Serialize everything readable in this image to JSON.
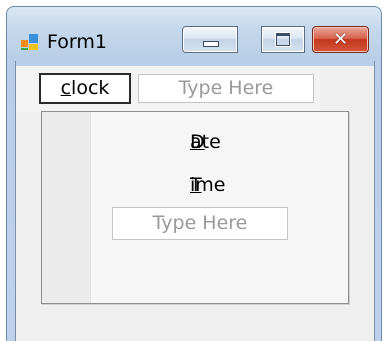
{
  "window": {
    "title": "Form1",
    "icon": "form-icon",
    "controls": {
      "minimize": "minimize-icon",
      "maximize": "maximize-icon",
      "close": "close-icon",
      "close_glyph": "✕"
    }
  },
  "menu": {
    "clock": {
      "mnemonic": "c",
      "rest": "lock"
    },
    "type_here": "Type Here"
  },
  "dropdown": {
    "items": [
      {
        "mnemonic": "D",
        "rest": "ate"
      },
      {
        "mnemonic": "T",
        "rest": "ime"
      }
    ],
    "type_here": "Type Here"
  },
  "colors": {
    "close_button": "#c2371c",
    "client_background": "#efefef"
  }
}
